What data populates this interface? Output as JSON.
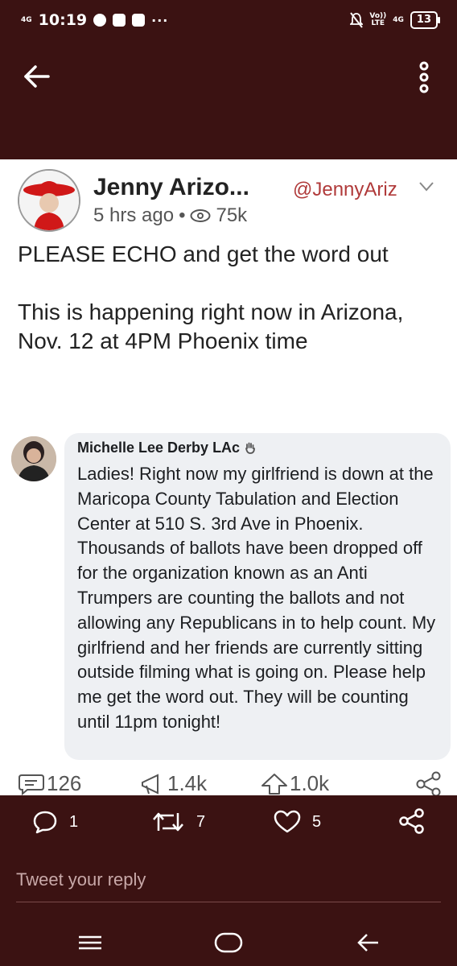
{
  "status_bar": {
    "network": "4G",
    "time": "10:19",
    "more": "···",
    "volte_top": "Vo))",
    "volte_bottom": "LTE",
    "network_right": "4G",
    "battery": "13"
  },
  "app_bar": {
    "back_icon": "arrow-left-icon",
    "more_icon": "vertical-dots-icon"
  },
  "post": {
    "display_name": "Jenny Arizo...",
    "handle": "@JennyAriz",
    "time_ago": "5 hrs ago",
    "separator": "•",
    "views": "75k",
    "paragraph_1": "PLEASE ECHO and get the word out",
    "paragraph_2": "This is happening right now in Arizona, Nov. 12 at 4PM Phoenix time",
    "quoted": {
      "author": "Michelle Lee Derby LAc",
      "text": "Ladies! Right now my girlfriend is down at the Maricopa County Tabulation and Election Center at 510 S. 3rd Ave in Phoenix. Thousands of ballots have been dropped off for the organization known as an Anti Trumpers are counting the ballots and not allowing any Republicans in to help count. My girlfriend and her friends are currently sitting outside filming what is going on. Please help me get the word out. They will be counting until 11pm tonight!"
    },
    "stats": {
      "comments": "126",
      "shares": "1.4k",
      "likes": "1.0k"
    }
  },
  "actions": {
    "reply_count": "1",
    "retweet_count": "7",
    "like_count": "5"
  },
  "reply_box": {
    "placeholder": "Tweet your reply"
  },
  "colors": {
    "brand_bg": "#3b1212",
    "handle": "#b03a3a"
  }
}
